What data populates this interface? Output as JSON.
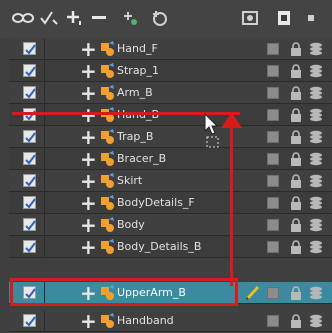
{
  "toolbar": {
    "icons": [
      "show-all-icon",
      "animate-icon",
      "add-layer-icon",
      "remove-layer-icon",
      "add-peg-icon",
      "add-drawing-icon",
      "snapshot-icon",
      "color-swatch-icon"
    ]
  },
  "layers": [
    {
      "name": "Hand_F",
      "checked": true,
      "selected": false
    },
    {
      "name": "Strap_1",
      "checked": true,
      "selected": false
    },
    {
      "name": "Arm_B",
      "checked": true,
      "selected": false
    },
    {
      "name": "Hand_B",
      "checked": true,
      "selected": false
    },
    {
      "name": "Trap_B",
      "checked": true,
      "selected": false
    },
    {
      "name": "Bracer_B",
      "checked": true,
      "selected": false
    },
    {
      "name": "Skirt",
      "checked": true,
      "selected": false
    },
    {
      "name": "BodyDetails_F",
      "checked": true,
      "selected": false
    },
    {
      "name": "Body",
      "checked": true,
      "selected": false
    },
    {
      "name": "Body_Details_B",
      "checked": true,
      "selected": false
    },
    {
      "name": "UpperArm_B",
      "checked": true,
      "selected": true
    },
    {
      "name": "Handband",
      "checked": true,
      "selected": false
    }
  ],
  "colors": {
    "annotation": "#d41c1c",
    "selected_row": "#3c8aa0",
    "node_orange": "#f0a030"
  }
}
